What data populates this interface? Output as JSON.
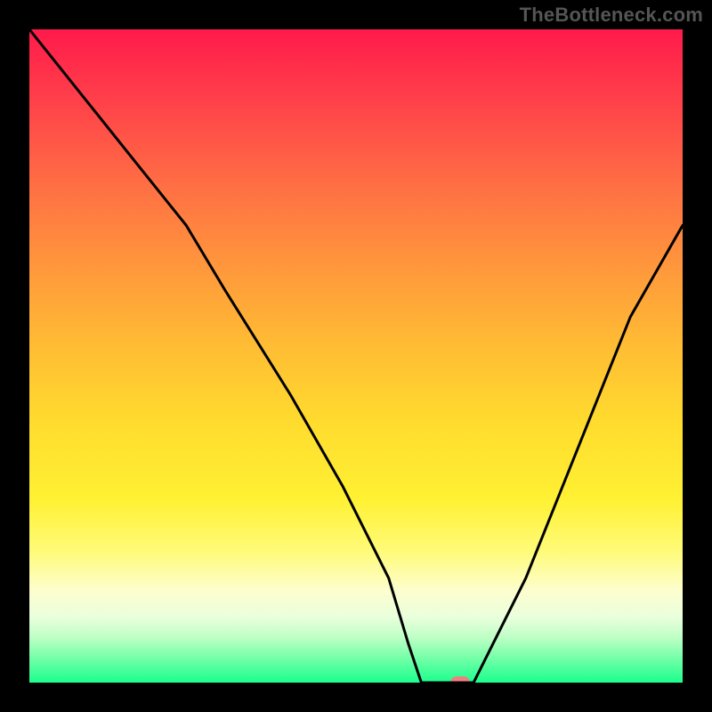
{
  "watermark": "TheBottleneck.com",
  "chart_data": {
    "type": "line",
    "title": "",
    "xlabel": "",
    "ylabel": "",
    "xlim": [
      0,
      100
    ],
    "ylim": [
      0,
      100
    ],
    "grid": false,
    "legend": false,
    "series": [
      {
        "name": "curve",
        "x": [
          0,
          8,
          16,
          24,
          30,
          40,
          48,
          55,
          58,
          60,
          65,
          68,
          76,
          84,
          92,
          100
        ],
        "y": [
          100,
          90,
          80,
          70,
          60,
          44,
          30,
          16,
          6,
          0,
          0,
          0,
          16,
          36,
          56,
          70
        ]
      }
    ],
    "marker": {
      "x": 66,
      "y": 0,
      "color": "#ef7f82"
    },
    "background_gradient": {
      "direction": "vertical",
      "stops": [
        {
          "pos": 0,
          "color": "#ff1a4b"
        },
        {
          "pos": 24,
          "color": "#ff6f44"
        },
        {
          "pos": 48,
          "color": "#ffbb34"
        },
        {
          "pos": 72,
          "color": "#fff133"
        },
        {
          "pos": 90,
          "color": "#e9ffdc"
        },
        {
          "pos": 100,
          "color": "#1aff8d"
        }
      ]
    }
  }
}
